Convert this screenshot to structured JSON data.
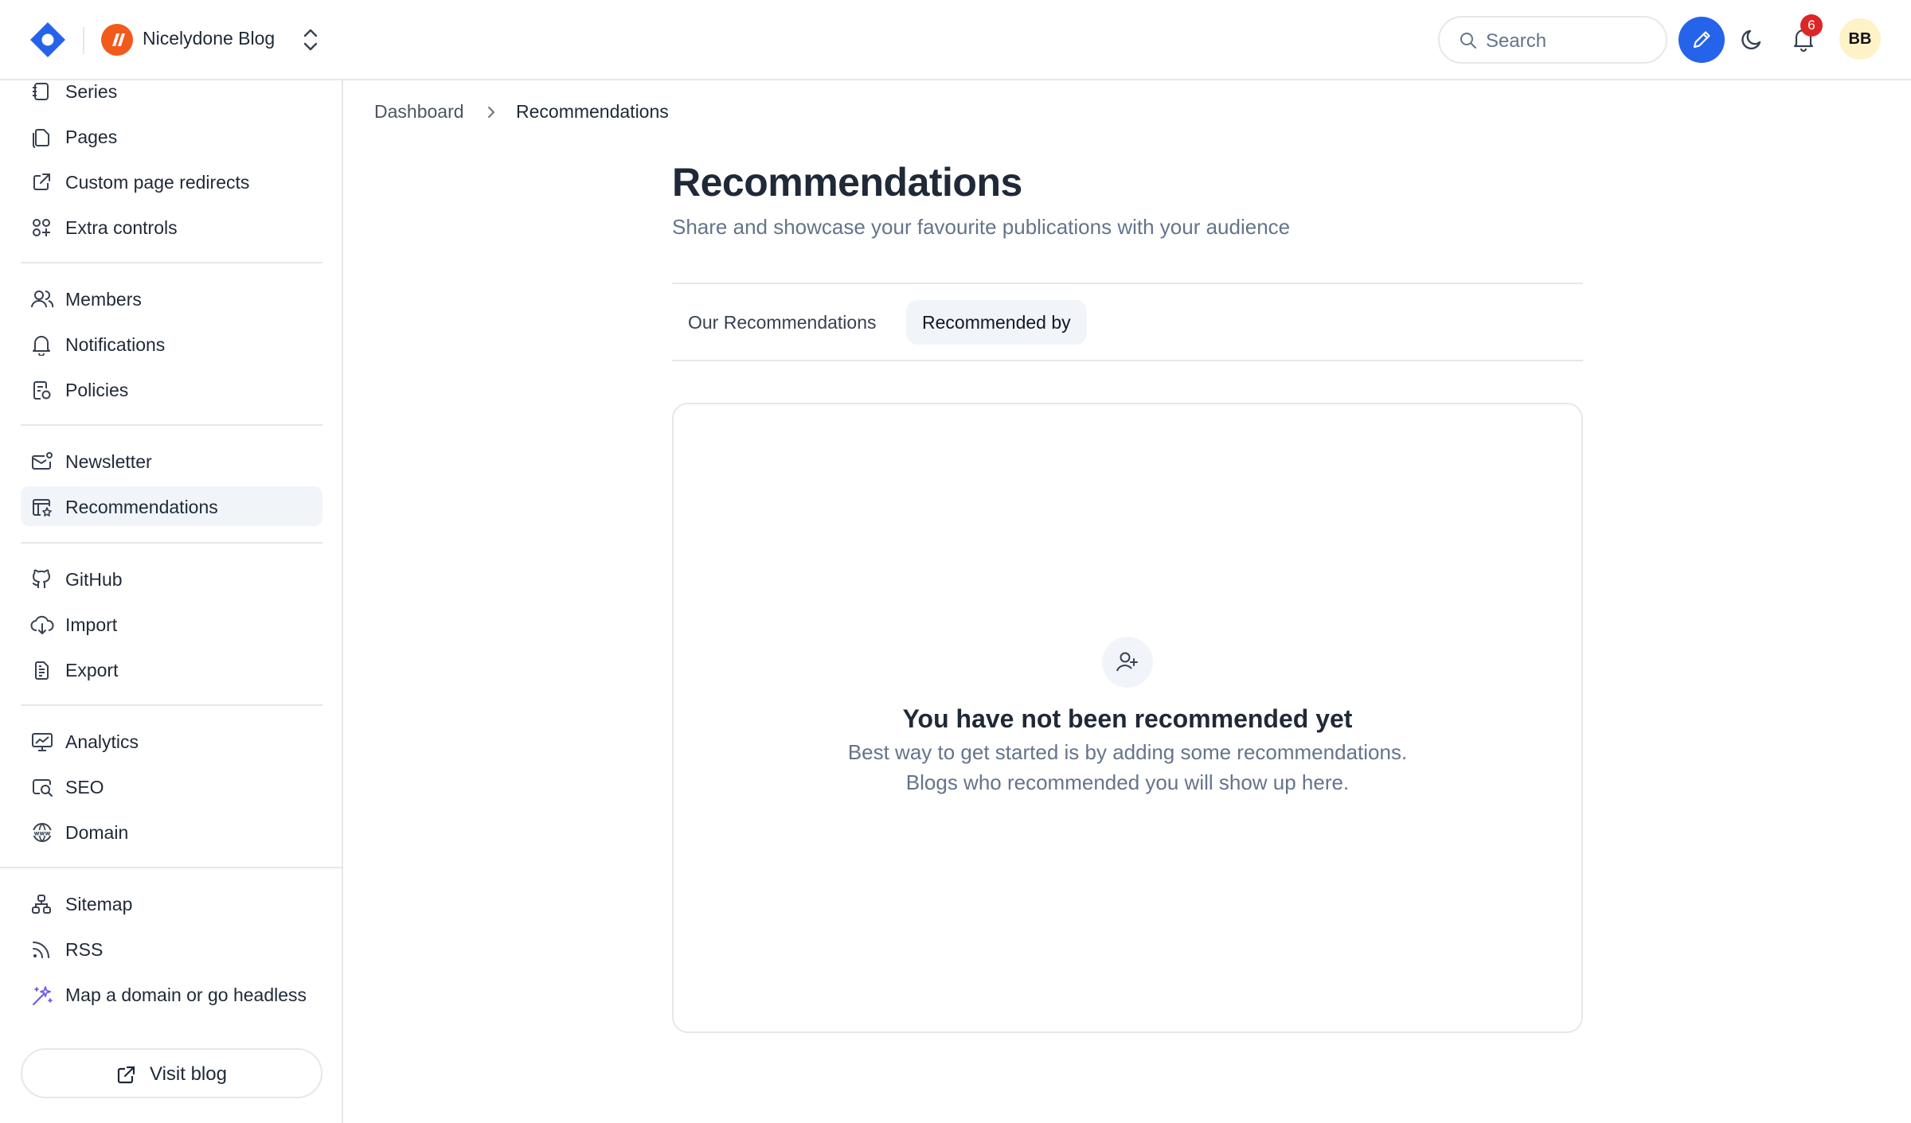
{
  "header": {
    "blog_name": "Nicelydone Blog",
    "search_placeholder": "Search",
    "notification_count": "6",
    "avatar_initials": "BB",
    "accent_color": "#2563eb"
  },
  "sidebar": {
    "items": [
      {
        "label": "Series",
        "icon": "series-icon"
      },
      {
        "label": "Pages",
        "icon": "pages-icon"
      },
      {
        "label": "Custom page redirects",
        "icon": "external-link-icon"
      },
      {
        "label": "Extra controls",
        "icon": "extra-controls-icon"
      },
      {
        "label": "Members",
        "icon": "members-icon"
      },
      {
        "label": "Notifications",
        "icon": "bell-icon"
      },
      {
        "label": "Policies",
        "icon": "policies-icon"
      },
      {
        "label": "Newsletter",
        "icon": "newsletter-icon"
      },
      {
        "label": "Recommendations",
        "icon": "recommendations-icon",
        "active": true
      },
      {
        "label": "GitHub",
        "icon": "github-icon"
      },
      {
        "label": "Import",
        "icon": "import-icon"
      },
      {
        "label": "Export",
        "icon": "export-icon"
      },
      {
        "label": "Analytics",
        "icon": "analytics-icon"
      },
      {
        "label": "SEO",
        "icon": "seo-icon"
      },
      {
        "label": "Domain",
        "icon": "domain-icon"
      },
      {
        "label": "Sitemap",
        "icon": "sitemap-icon"
      },
      {
        "label": "RSS",
        "icon": "rss-icon"
      },
      {
        "label": "Map a domain or go headless",
        "icon": "magic-wand-icon"
      }
    ],
    "visit_blog_label": "Visit blog"
  },
  "breadcrumb": {
    "root": "Dashboard",
    "current": "Recommendations"
  },
  "main": {
    "title": "Recommendations",
    "subtitle": "Share and showcase your favourite publications with your audience",
    "tabs": [
      {
        "label": "Our Recommendations",
        "active": false
      },
      {
        "label": "Recommended by",
        "active": true
      }
    ],
    "empty_state": {
      "title": "You have not been recommended yet",
      "line1": "Best way to get started is by adding some recommendations.",
      "line2": "Blogs who recommended you will show up here."
    }
  }
}
